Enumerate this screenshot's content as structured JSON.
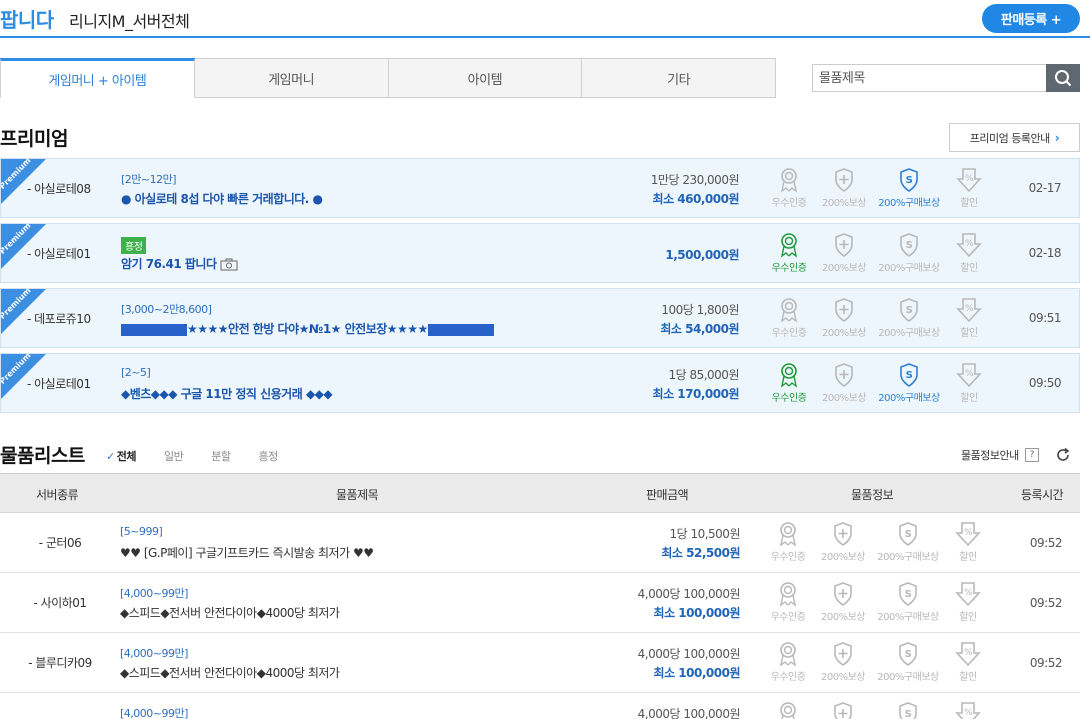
{
  "header": {
    "brand": "팝니다",
    "game": "리니지M_서버전체",
    "sell_button": "판매등록 +"
  },
  "tabs": [
    {
      "label": "게임머니 + 아이템",
      "active": true
    },
    {
      "label": "게임머니",
      "active": false
    },
    {
      "label": "아이템",
      "active": false
    },
    {
      "label": "기타",
      "active": false
    }
  ],
  "search": {
    "placeholder": "물품제목"
  },
  "premium": {
    "title": "프리미엄",
    "guide_button": "프리미엄 등록안내",
    "ribbon_text": "Premium",
    "rows": [
      {
        "server": "- 아실로테08",
        "range": "[2만~12만]",
        "title": "● 아실로테 8섭 다야 빠른 거래합니다. ●",
        "unit_price": "1만당 230,000원",
        "min_price": "최소 460,000원",
        "certified": false,
        "comp200": false,
        "buy200": true,
        "discount": false,
        "date": "02-17"
      },
      {
        "server": "- 아실로테01",
        "badge": "흥정",
        "title": "암기 76.41 팝니다",
        "min_price": "1,500,000원",
        "certified": true,
        "comp200": false,
        "buy200": false,
        "discount": false,
        "date": "02-18"
      },
      {
        "server": "- 데포로쥬10",
        "range": "[3,000~2만8,600]",
        "title": "★★★★안전 한방 다야★№1★ 안전보장★★★★",
        "unit_price": "100당 1,800원",
        "min_price": "최소 54,000원",
        "certified": false,
        "comp200": false,
        "buy200": false,
        "discount": false,
        "date": "09:51"
      },
      {
        "server": "- 아실로테01",
        "range": "[2~5]",
        "title": "◆벤츠◆◆◆ 구글 11만 정직 신용거래 ◆◆◆",
        "unit_price": "1당 85,000원",
        "min_price": "최소 170,000원",
        "certified": true,
        "comp200": false,
        "buy200": true,
        "discount": false,
        "date": "09:50"
      }
    ]
  },
  "icon_labels": {
    "certified": "우수인증",
    "comp200": "200%보상",
    "buy200": "200%구매보상",
    "discount": "할인"
  },
  "list": {
    "title": "물품리스트",
    "filters": [
      "전체",
      "일반",
      "분할",
      "흥정"
    ],
    "info_guide": "물품정보안내",
    "help": "?",
    "columns": [
      "서버종류",
      "물품제목",
      "판매금액",
      "물품정보",
      "등록시간"
    ],
    "rows": [
      {
        "server": "- 군터06",
        "range": "[5~999]",
        "title": "♥♥ [G.P페이] 구글기프트카드 즉시발송 최저가 ♥♥",
        "unit_price": "1당 10,500원",
        "min_price": "최소 52,500원",
        "date": "09:52"
      },
      {
        "server": "- 사이하01",
        "range": "[4,000~99만]",
        "title": "◆스피드◆전서버 안전다이아◆4000당 최저가",
        "unit_price": "4,000당 100,000원",
        "min_price": "최소 100,000원",
        "date": "09:52"
      },
      {
        "server": "- 블루디카09",
        "range": "[4,000~99만]",
        "title": "◆스피드◆전서버 안전다이아◆4000당 최저가",
        "unit_price": "4,000당 100,000원",
        "min_price": "최소 100,000원",
        "date": "09:52"
      },
      {
        "server": "",
        "range": "[4,000~99만]",
        "title": "",
        "unit_price": "4,000당 100,000원",
        "min_price": "",
        "date": ""
      }
    ]
  },
  "colors": {
    "accent": "#2d8de3",
    "premium_bg": "#eef6fd",
    "price": "#1e64b8",
    "green": "#1e9a3a"
  }
}
